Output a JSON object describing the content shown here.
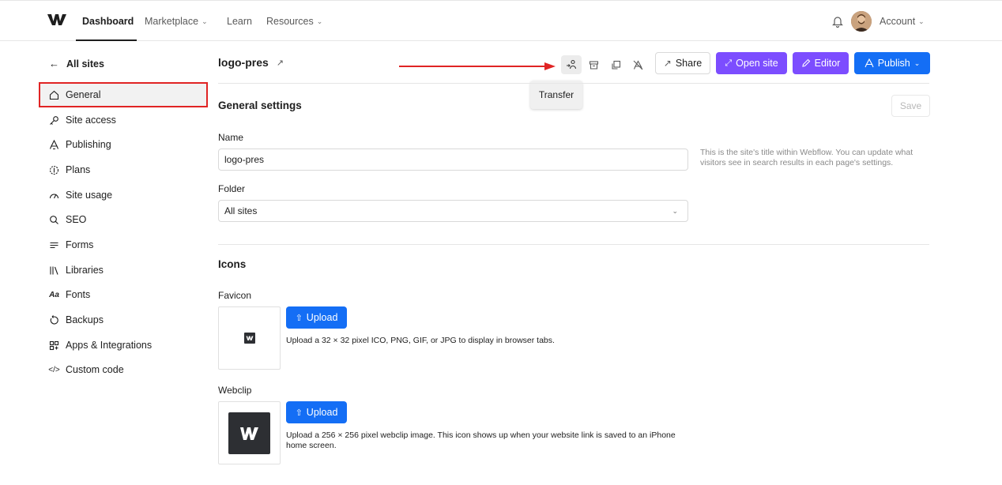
{
  "nav": {
    "items": [
      "Dashboard",
      "Marketplace",
      "Learn",
      "Resources"
    ],
    "account": "Account"
  },
  "sidebar": {
    "back": "All sites",
    "items": [
      {
        "label": "General",
        "icon": "home-icon"
      },
      {
        "label": "Site access",
        "icon": "key-icon"
      },
      {
        "label": "Publishing",
        "icon": "rocket-icon"
      },
      {
        "label": "Plans",
        "icon": "plans-icon"
      },
      {
        "label": "Site usage",
        "icon": "gauge-icon"
      },
      {
        "label": "SEO",
        "icon": "search-icon"
      },
      {
        "label": "Forms",
        "icon": "forms-icon"
      },
      {
        "label": "Libraries",
        "icon": "libraries-icon"
      },
      {
        "label": "Fonts",
        "icon": "fonts-icon"
      },
      {
        "label": "Backups",
        "icon": "backup-icon"
      },
      {
        "label": "Apps & Integrations",
        "icon": "apps-icon"
      },
      {
        "label": "Custom code",
        "icon": "code-icon"
      }
    ]
  },
  "header": {
    "site_name": "logo-pres",
    "tooltip": "Transfer",
    "share": "Share",
    "open_site": "Open site",
    "editor": "Editor",
    "publish": "Publish"
  },
  "general": {
    "title": "General settings",
    "save": "Save",
    "name_label": "Name",
    "name_value": "logo-pres",
    "helper": "This is the site's title within Webflow. You can update what visitors see in search results in each page's settings.",
    "folder_label": "Folder",
    "folder_value": "All sites"
  },
  "icons": {
    "title": "Icons",
    "favicon_label": "Favicon",
    "favicon_upload": "Upload",
    "favicon_desc": "Upload a 32 × 32 pixel ICO, PNG, GIF, or JPG to display in browser tabs.",
    "webclip_label": "Webclip",
    "webclip_upload": "Upload",
    "webclip_desc": "Upload a 256 × 256 pixel webclip image. This icon shows up when your website link is saved to an iPhone home screen."
  },
  "colors": {
    "purple": "#7c4dff",
    "blue": "#146ef5",
    "highlight_red": "#e02424"
  }
}
